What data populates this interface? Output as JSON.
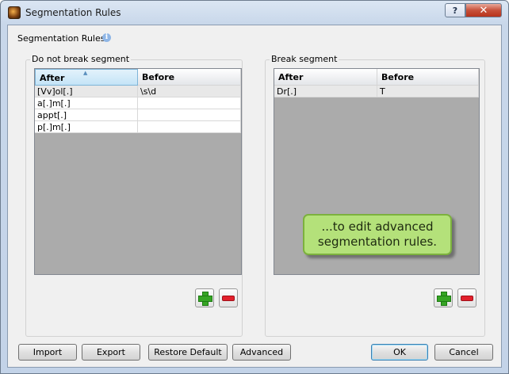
{
  "window": {
    "title": "Segmentation Rules",
    "help_label": "?",
    "close_label": "✕"
  },
  "section": {
    "title": "Segmentation Rules",
    "info_icon": "i"
  },
  "no_break": {
    "label": "Do not break segment",
    "columns": [
      "After",
      "Before"
    ],
    "rows": [
      [
        "[Vv]ol[.]",
        "\\s\\d"
      ],
      [
        "a[.]m[.]",
        ""
      ],
      [
        "appt[.]",
        ""
      ],
      [
        "p[.]m[.]",
        ""
      ]
    ]
  },
  "break": {
    "label": "Break segment",
    "columns": [
      "After",
      "Before"
    ],
    "rows": [
      [
        "Dr[.]",
        "T"
      ]
    ]
  },
  "tooltip": {
    "line1": "...to edit advanced",
    "line2": "segmentation rules."
  },
  "buttons": {
    "import": "Import",
    "export": "Export",
    "restore_default": "Restore Default",
    "advanced": "Advanced",
    "ok": "OK",
    "cancel": "Cancel"
  },
  "icons": {
    "add": "plus-icon",
    "remove": "minus-icon"
  }
}
